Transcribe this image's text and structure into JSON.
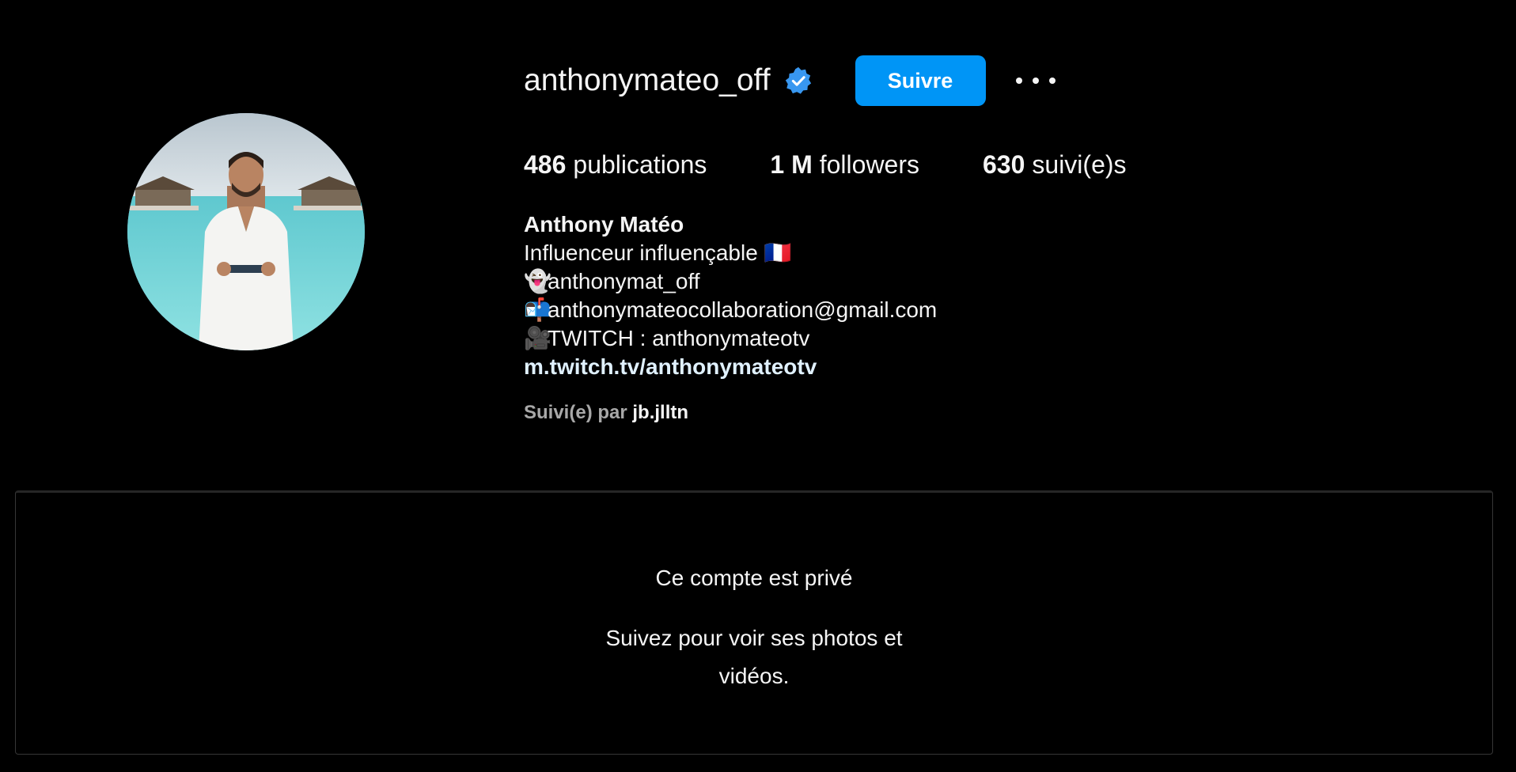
{
  "profile": {
    "username": "anthonymateo_off",
    "follow_label": "Suivre",
    "display_name": "Anthony Matéo",
    "avatar_icon": "profile-photo",
    "verified_icon": "verified-badge-icon",
    "more_icon": "more-options-icon"
  },
  "stats": {
    "posts_count": "486",
    "posts_label": "publications",
    "followers_count": "1 M",
    "followers_label": "followers",
    "following_count": "630",
    "following_label": "suivi(e)s"
  },
  "bio": {
    "line1_text": "Influenceur influençable",
    "line1_emoji": "🇫🇷",
    "line2_emoji": "👻",
    "line2_text": "anthonymat_off",
    "line3_emoji": "📬",
    "line3_text": "anthonymateocollaboration@gmail.com",
    "line4_emoji": "🎥",
    "line4_text": "TWITCH : anthonymateotv",
    "link": "m.twitch.tv/anthonymateotv"
  },
  "followed_by": {
    "prefix": "Suivi(e) par",
    "user": "jb.jlltn"
  },
  "private": {
    "title": "Ce compte est privé",
    "subtitle": "Suivez pour voir ses photos et vidéos."
  },
  "colors": {
    "background": "#000000",
    "accent": "#0095f6",
    "text": "#f5f5f5",
    "muted": "#a8a8a8",
    "link": "#e0f1ff"
  }
}
